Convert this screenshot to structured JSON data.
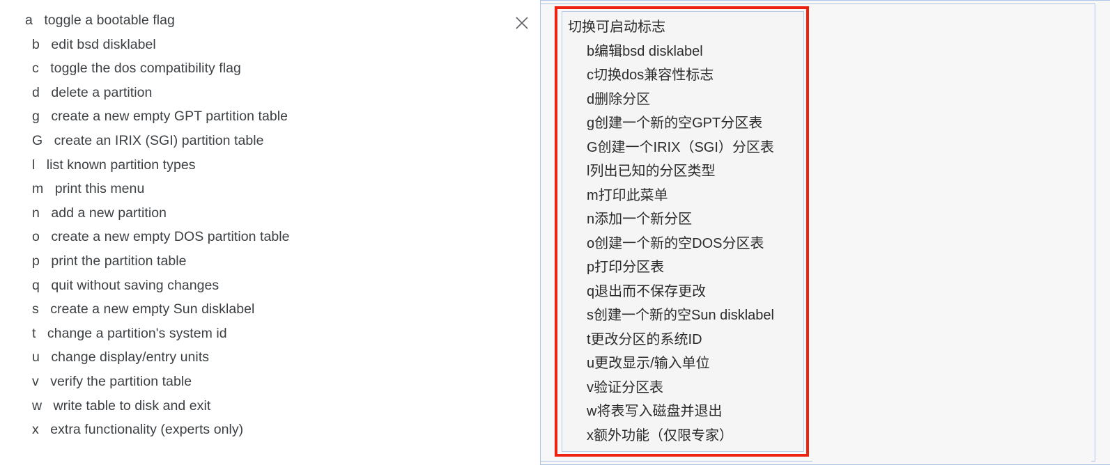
{
  "source_pane": {
    "name": "fdisk-command-help",
    "lines": [
      {
        "key": "a",
        "desc": "toggle a bootable flag"
      },
      {
        "key": "b",
        "desc": "edit bsd disklabel"
      },
      {
        "key": "c",
        "desc": "toggle the dos compatibility flag"
      },
      {
        "key": "d",
        "desc": "delete a partition"
      },
      {
        "key": "g",
        "desc": "create a new empty GPT partition table"
      },
      {
        "key": "G",
        "desc": "create an IRIX (SGI) partition table"
      },
      {
        "key": "l",
        "desc": "list known partition types"
      },
      {
        "key": "m",
        "desc": "print this menu"
      },
      {
        "key": "n",
        "desc": "add a new partition"
      },
      {
        "key": "o",
        "desc": "create a new empty DOS partition table"
      },
      {
        "key": "p",
        "desc": "print the partition table"
      },
      {
        "key": "q",
        "desc": "quit without saving changes"
      },
      {
        "key": "s",
        "desc": "create a new empty Sun disklabel"
      },
      {
        "key": "t",
        "desc": "change a partition's system id"
      },
      {
        "key": "u",
        "desc": "change display/entry units"
      },
      {
        "key": "v",
        "desc": "verify the partition table"
      },
      {
        "key": "w",
        "desc": "write table to disk and exit"
      },
      {
        "key": "x",
        "desc": "extra functionality (experts only)"
      }
    ],
    "full_text": [
      "a   toggle a bootable flag",
      "b   edit bsd disklabel",
      "c   toggle the dos compatibility flag",
      "d   delete a partition",
      "g   create a new empty GPT partition table",
      "G   create an IRIX (SGI) partition table",
      "l   list known partition types",
      "m   print this menu",
      "n   add a new partition",
      "o   create a new empty DOS partition table",
      "p   print the partition table",
      "q   quit without saving changes",
      "s   create a new empty Sun disklabel",
      "t   change a partition's system id",
      "u   change display/entry units",
      "v   verify the partition table",
      "w   write table to disk and exit",
      "x   extra functionality (experts only)"
    ]
  },
  "close_button": {
    "icon": "close-icon",
    "label": "×"
  },
  "translation_panel": {
    "name": "chinese-translation-output",
    "lines": [
      "切换可启动标志",
      "b编辑bsd disklabel",
      "c切换dos兼容性标志",
      "d删除分区",
      "g创建一个新的空GPT分区表",
      "G创建一个IRIX（SGI）分区表",
      "l列出已知的分区类型",
      "m打印此菜单",
      "n添加一个新分区",
      "o创建一个新的空DOS分区表",
      "p打印分区表",
      "q退出而不保存更改",
      "s创建一个新的空Sun disklabel",
      "t更改分区的系统ID",
      "u更改显示/输入单位",
      "v验证分区表",
      "w将表写入磁盘并退出",
      "x额外功能（仅限专家）"
    ]
  },
  "colors": {
    "highlight_border": "#ee2211",
    "panel_border": "#aec4e8",
    "textbox_border": "#b6cbe8",
    "panel_background": "#f7f7f7",
    "textbox_background": "#f5f5f5",
    "source_text": "#3c4043",
    "translation_text": "#2b2b2b",
    "close_icon": "#5f6368"
  }
}
